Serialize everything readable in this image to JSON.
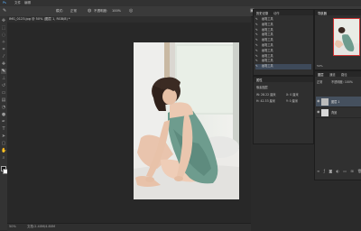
{
  "menubar": {
    "items": [
      "Ps",
      "文件",
      "编辑",
      "图像",
      "图层",
      "文字",
      "选择",
      "滤镜",
      "3D",
      "视图",
      "窗口",
      "帮助"
    ]
  },
  "options": {
    "labels": [
      "模式:",
      "正常",
      "不透明度:",
      "100%",
      "流量:",
      "100%"
    ]
  },
  "document": {
    "tab_title": "IMG_0123.jpg @ 50% (图层 1, RGB/8) *",
    "zoom": "50%",
    "status": "文档:2.40M/4.80M"
  },
  "history": {
    "tabs": [
      "历史记录",
      "动作"
    ],
    "rows": [
      "画笔工具",
      "画笔工具",
      "画笔工具",
      "画笔工具",
      "画笔工具",
      "画笔工具",
      "画笔工具",
      "画笔工具",
      "画笔工具",
      "画笔工具"
    ],
    "selected_index": 9
  },
  "properties": {
    "title": "属性",
    "rows": [
      "像素图层",
      "W: 28.22 厘米",
      "X: 0 厘米",
      "H: 42.33 厘米",
      "Y: 0 厘米"
    ]
  },
  "navigator": {
    "title": "导航器",
    "zoom": "50%"
  },
  "layers": {
    "tabs": [
      "图层",
      "通道",
      "路径"
    ],
    "blend_mode": "正常",
    "opacity": "不透明度: 100%",
    "rows": [
      {
        "name": "图层 1"
      },
      {
        "name": "背景"
      }
    ],
    "selected_index": 0
  },
  "icons": [
    "move-icon",
    "marquee-icon",
    "lasso-icon",
    "magic-wand-icon",
    "crop-icon",
    "eyedropper-icon",
    "healing-icon",
    "brush-icon",
    "stamp-icon",
    "history-brush-icon",
    "eraser-icon",
    "gradient-icon",
    "blur-icon",
    "dodge-icon",
    "pen-icon",
    "type-icon",
    "path-select-icon",
    "shape-icon",
    "hand-icon",
    "zoom-icon"
  ]
}
